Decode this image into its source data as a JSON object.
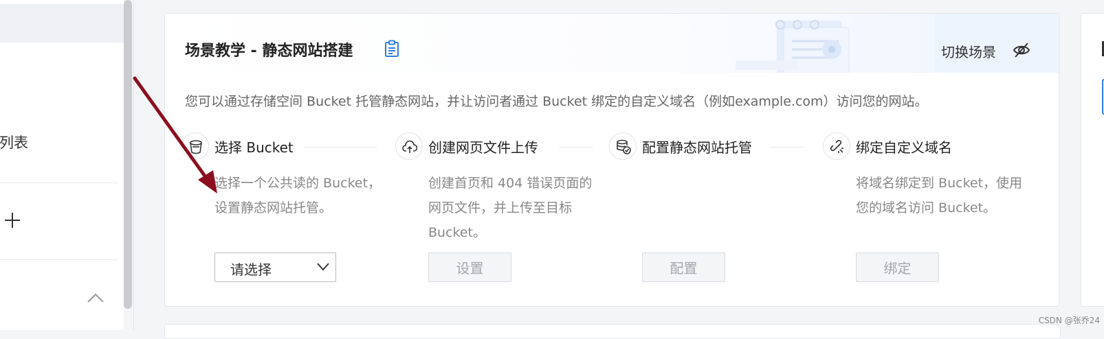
{
  "sidebar": {
    "item_label": "表列表",
    "plus_icon": "plus-icon",
    "chevron_icon": "chevron-up-icon"
  },
  "card": {
    "title": "场景教学 - 静态网站搭建",
    "title_icon": "clipboard-icon",
    "switch_label": "切换场景",
    "switch_icon": "eye-off-icon",
    "description": "您可以通过存储空间 Bucket 托管静态网站，并让访问者通过 Bucket 绑定的自定义域名（例如example.com）访问您的网站。",
    "steps": [
      {
        "title": "选择 Bucket",
        "icon": "bucket-icon",
        "desc": "选择一个公共读的 Bucket，设置静态网站托管。",
        "control": "select",
        "control_label": "请选择"
      },
      {
        "title": "创建网页文件上传",
        "icon": "cloud-upload-icon",
        "desc": "创建首页和 404 错误页面的网页文件，并上传至目标 Bucket。",
        "control": "button",
        "control_label": "设置"
      },
      {
        "title": "配置静态网站托管",
        "icon": "database-check-icon",
        "desc": "",
        "control": "button",
        "control_label": "配置"
      },
      {
        "title": "绑定自定义域名",
        "icon": "link-icon",
        "desc": "将域名绑定到 Bucket，使用您的域名访问 Bucket。",
        "control": "button",
        "control_label": "绑定"
      }
    ]
  },
  "annotation": {
    "arrow_color": "#8b0f1f"
  },
  "watermark": "CSDN @张乔24",
  "colors": {
    "accent": "#2f7ce0",
    "disabled_text": "#a3a6ab"
  }
}
